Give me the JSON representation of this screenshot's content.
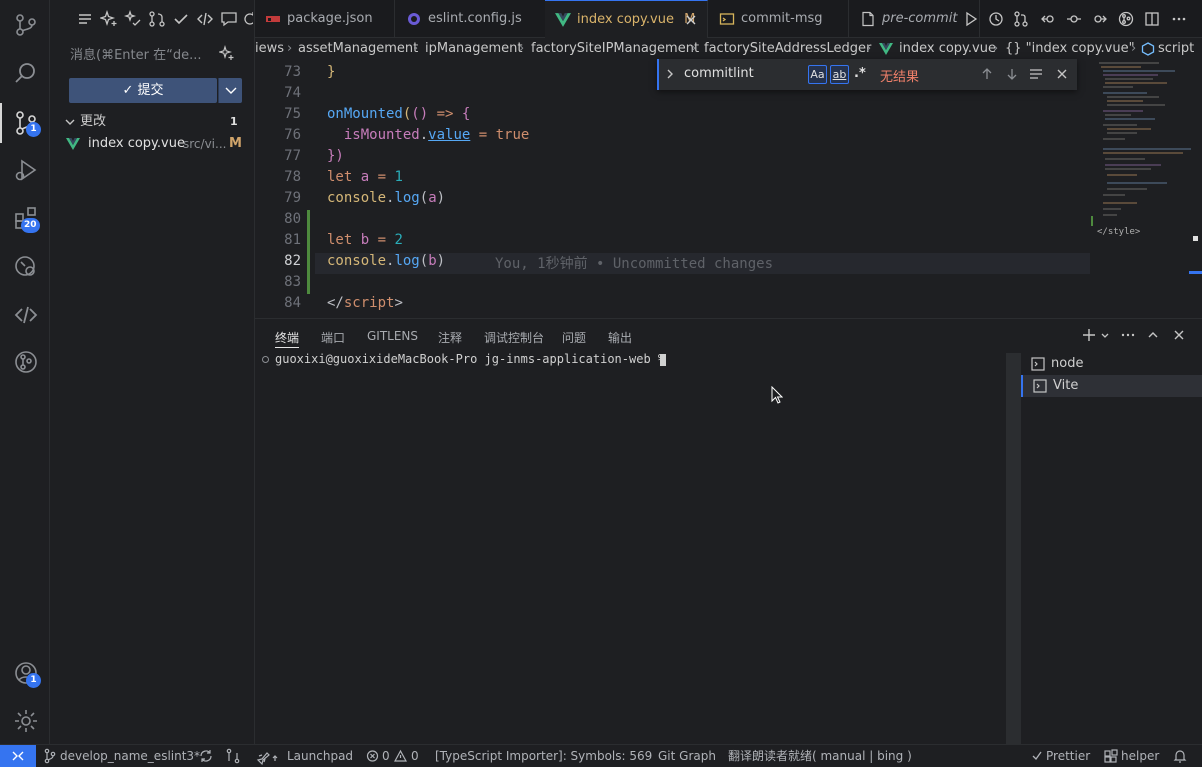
{
  "activity": {
    "scm_badge": "1",
    "extensions_badge": "20",
    "accounts_badge": "1"
  },
  "sidebar": {
    "message_placeholder": "消息(⌘Enter 在“de...",
    "commit_label": "✓ 提交",
    "changes_header": "更改",
    "changes_count": "1",
    "file": {
      "name": "index copy.vue",
      "path": "src/vi...",
      "status": "M"
    }
  },
  "tabs": [
    {
      "label": "package.json"
    },
    {
      "label": "eslint.config.js"
    },
    {
      "label": "index copy.vue",
      "status": "M"
    },
    {
      "label": "commit-msg"
    },
    {
      "label": "pre-commit"
    }
  ],
  "breadcrumb": {
    "parts": [
      "iews",
      "assetManagement",
      "ipManagement",
      "factorySiteIPManagement",
      "factorySiteAddressLedger",
      "index copy.vue",
      "{} \"index copy.vue\"",
      "script"
    ]
  },
  "editor": {
    "line_numbers": [
      "73",
      "74",
      "75",
      "76",
      "77",
      "78",
      "79",
      "80",
      "81",
      "82",
      "83",
      "84"
    ],
    "blame": "You, 1秒钟前 • Uncommitted changes",
    "minimap_style": "</style>"
  },
  "find": {
    "query": "commitlint",
    "case_label": "Aa",
    "word_label": "ab",
    "regex_label": ".*",
    "result": "无结果"
  },
  "panel": {
    "tabs": [
      "终端",
      "端口",
      "GITLENS",
      "注释",
      "调试控制台",
      "问题",
      "输出"
    ],
    "prompt": "guoxixi@guoxixideMacBook-Pro jg-inms-application-web %",
    "terminals": [
      "node",
      "Vite"
    ]
  },
  "status": {
    "branch": "develop_name_eslint3*",
    "launchpad": "Launchpad",
    "errors": "0",
    "warnings": "0",
    "ts_importer": "[TypeScript Importer]: Symbols: 569",
    "git_graph": "Git Graph",
    "translator": "翻译朗读者就绪( manual | bing )",
    "prettier": "Prettier",
    "helper": "helper"
  },
  "colors": {
    "accent": "#3574f0",
    "added_gutter": "#4e8a3e",
    "no_result": "#f0806a"
  }
}
